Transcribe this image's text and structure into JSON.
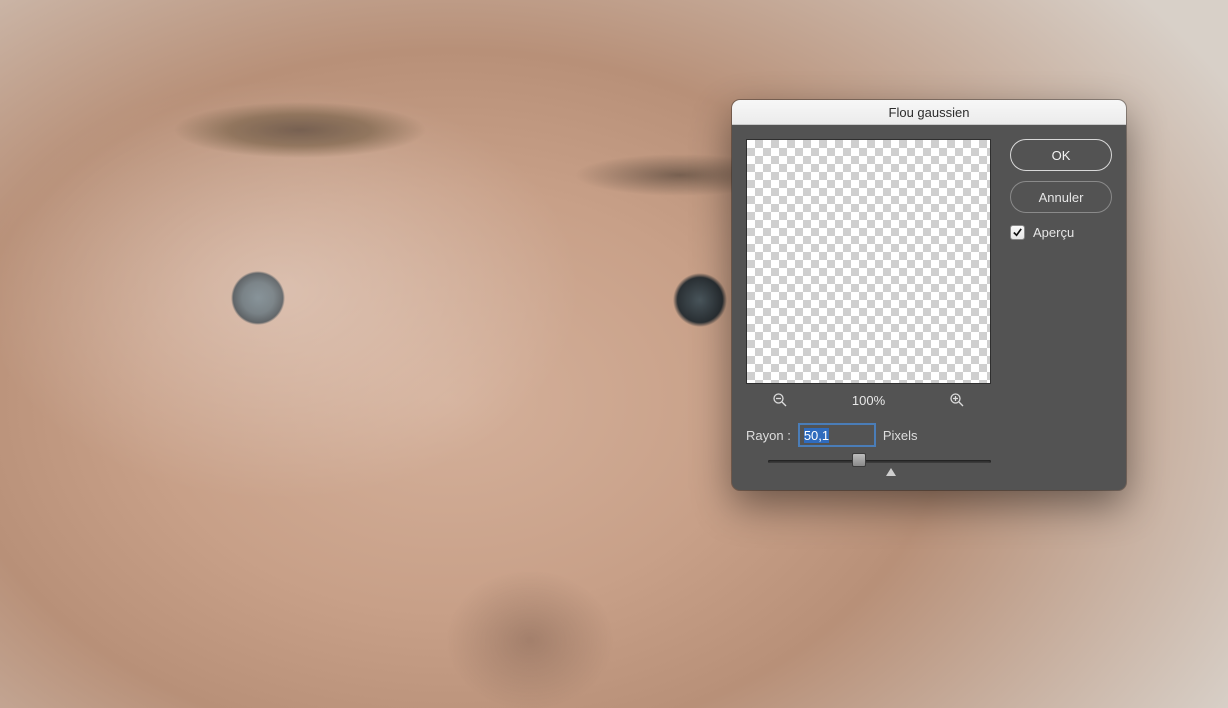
{
  "dialog": {
    "title": "Flou gaussien",
    "buttons": {
      "ok": "OK",
      "cancel": "Annuler"
    },
    "preview_label": "Aperçu",
    "preview_checked": true,
    "zoom_level": "100%",
    "radius_label": "Rayon :",
    "radius_value": "50,1",
    "radius_unit": "Pixels",
    "slider": {
      "thumb_percent": 41,
      "marker_percent": 55
    }
  },
  "icons": {
    "zoom_out": "zoom-out-icon",
    "zoom_in": "zoom-in-icon",
    "check": "check-icon"
  }
}
